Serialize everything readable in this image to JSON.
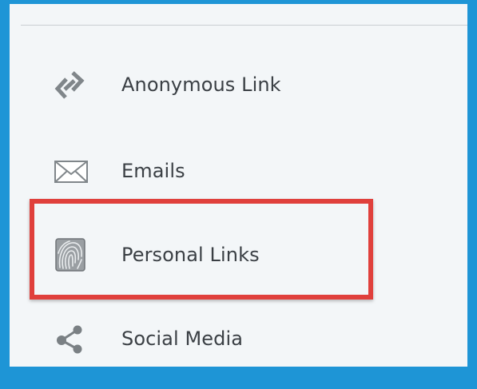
{
  "nav": {
    "items": [
      {
        "label": "Anonymous Link",
        "icon": "link-icon"
      },
      {
        "label": "Emails",
        "icon": "envelope-icon"
      },
      {
        "label": "Personal Links",
        "icon": "fingerprint-icon"
      },
      {
        "label": "Social Media",
        "icon": "share-icon"
      }
    ]
  },
  "colors": {
    "frame_border": "#1e95d6",
    "panel_background": "#f3f6f8",
    "highlight": "#e0403c",
    "text": "#3a3f44",
    "icon": "#7a8084"
  }
}
